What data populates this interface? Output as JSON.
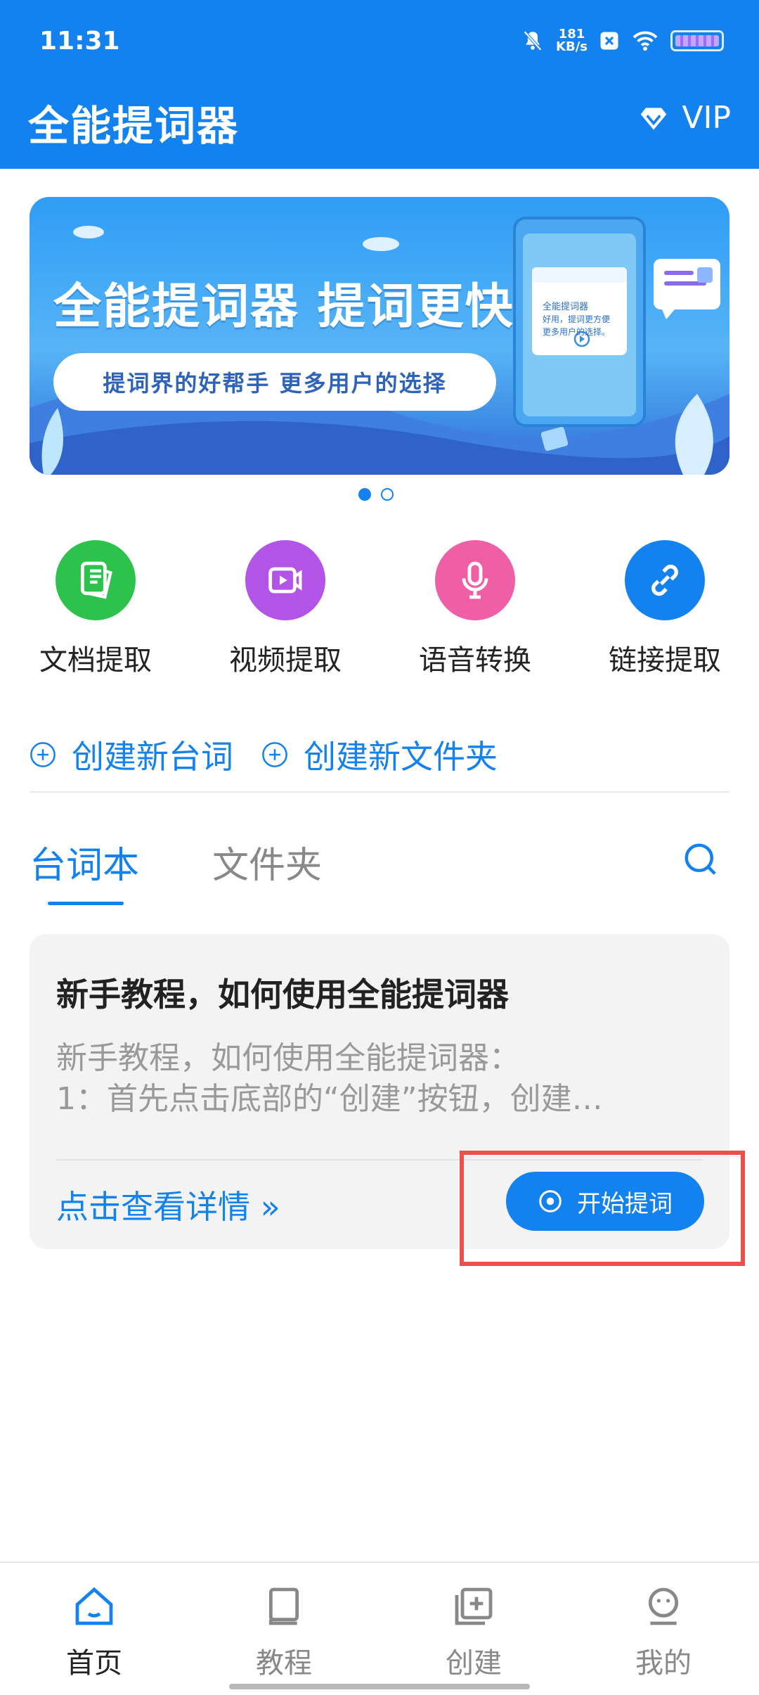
{
  "status_bar": {
    "time": "11:31",
    "speed_value": "181",
    "speed_unit": "KB/s",
    "icons": [
      "bell-muted-icon",
      "notification-icon",
      "wifi-icon",
      "battery-icon"
    ]
  },
  "header": {
    "title": "全能提词器",
    "vip_label": "VIP",
    "vip_icon": "diamond-icon"
  },
  "banner": {
    "title": "全能提词器 提词更快",
    "subtitle": "提词界的好帮手 更多用户的选择",
    "phone_card_title": "全能提词器",
    "phone_card_text_1": "好用，提词更方便",
    "phone_card_text_2": "更多用户的选择。",
    "page_count": 2,
    "active_page": 1
  },
  "tools": [
    {
      "label": "文档提取",
      "icon": "document-icon",
      "color": "#2dc24c"
    },
    {
      "label": "视频提取",
      "icon": "video-icon",
      "color": "#b255e6"
    },
    {
      "label": "语音转换",
      "icon": "microphone-icon",
      "color": "#ef5fa6"
    },
    {
      "label": "链接提取",
      "icon": "link-icon",
      "color": "#1482ee"
    }
  ],
  "create_actions": {
    "new_script": "创建新台词",
    "new_folder": "创建新文件夹"
  },
  "tabs": {
    "scripts": "台词本",
    "folders": "文件夹",
    "active": "台词本"
  },
  "script_card": {
    "title": "新手教程，如何使用全能提词器",
    "preview_line_1": "新手教程，如何使用全能提词器：",
    "preview_line_2": "1：首先点击底部的“创建”按钮，创建…",
    "detail_link": "点击查看详情 »",
    "start_button": "开始提词"
  },
  "bottom_nav": [
    {
      "label": "首页",
      "icon": "home-icon",
      "active": true
    },
    {
      "label": "教程",
      "icon": "book-icon",
      "active": false
    },
    {
      "label": "创建",
      "icon": "add-square-icon",
      "active": false
    },
    {
      "label": "我的",
      "icon": "smiley-user-icon",
      "active": false
    }
  ],
  "colors": {
    "primary": "#1482ee",
    "highlight": "#e8524a",
    "card_bg": "#f3f3f3"
  }
}
